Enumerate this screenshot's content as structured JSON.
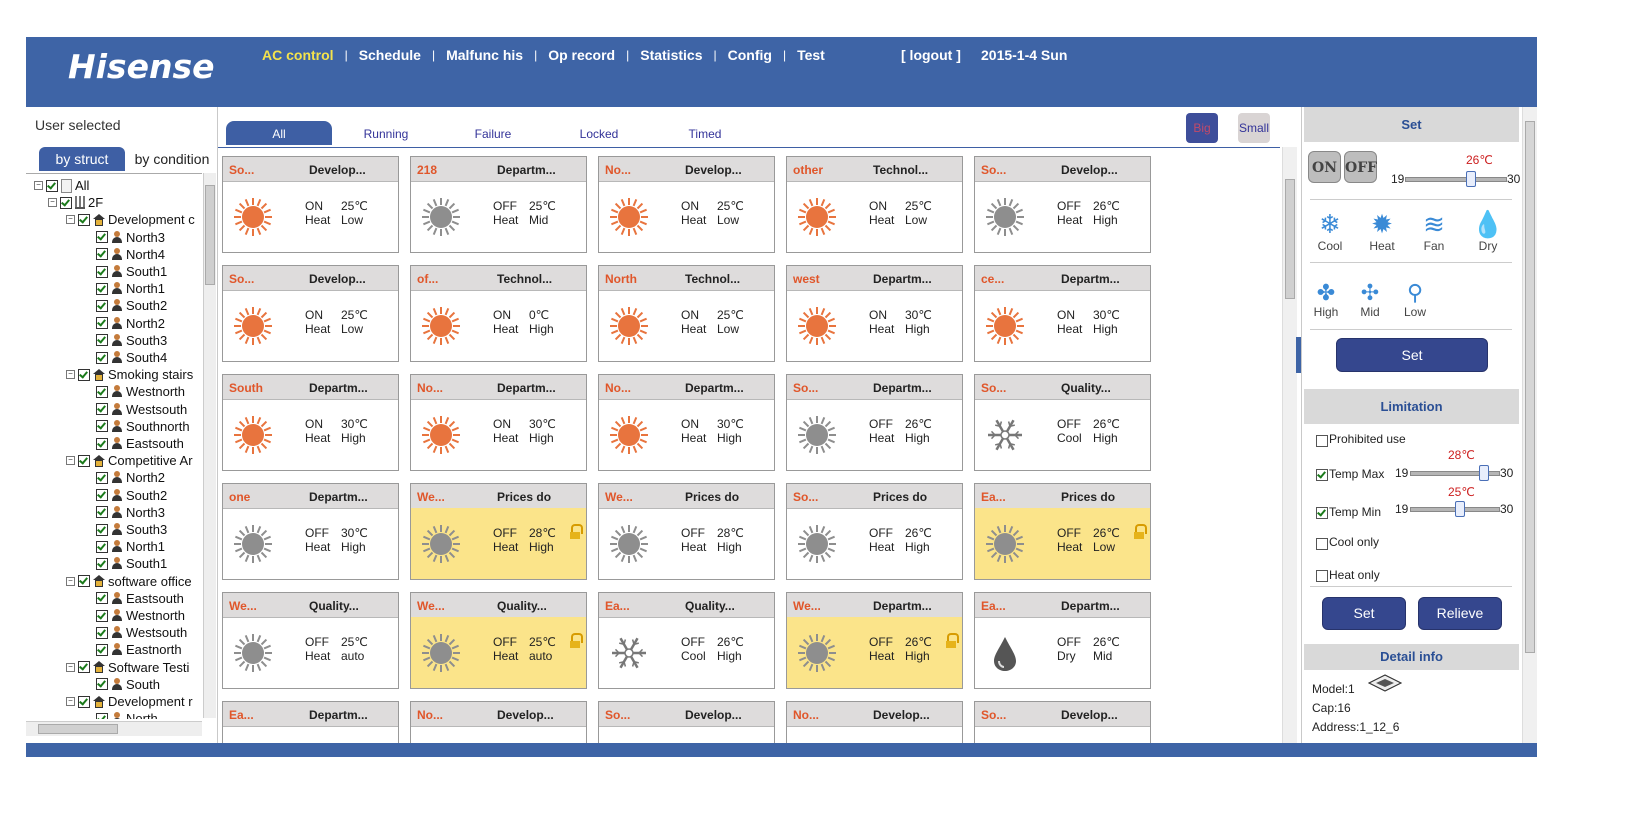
{
  "header": {
    "logo": "Hisense",
    "nav": [
      {
        "label": "AC control",
        "active": true
      },
      {
        "label": "Schedule"
      },
      {
        "label": "Malfunc his"
      },
      {
        "label": "Op record"
      },
      {
        "label": "Statistics"
      },
      {
        "label": "Config"
      },
      {
        "label": "Test"
      }
    ],
    "separator": "|",
    "logout": "[ logout ]",
    "date": "2015-1-4 Sun"
  },
  "left": {
    "title": "User selected",
    "tab_struct": "by struct",
    "tab_condition": "by condition",
    "tree": [
      {
        "label": "All",
        "level": 0,
        "icon": "doc",
        "toggle": "-"
      },
      {
        "label": "2F",
        "level": 1,
        "icon": "building",
        "toggle": "-"
      },
      {
        "label": "Development c",
        "level": 2,
        "icon": "home",
        "toggle": "-"
      },
      {
        "label": "North3",
        "level": 3,
        "icon": "user"
      },
      {
        "label": "North4",
        "level": 3,
        "icon": "user"
      },
      {
        "label": "South1",
        "level": 3,
        "icon": "user"
      },
      {
        "label": "North1",
        "level": 3,
        "icon": "user"
      },
      {
        "label": "South2",
        "level": 3,
        "icon": "user"
      },
      {
        "label": "North2",
        "level": 3,
        "icon": "user"
      },
      {
        "label": "South3",
        "level": 3,
        "icon": "user"
      },
      {
        "label": "South4",
        "level": 3,
        "icon": "user"
      },
      {
        "label": "Smoking stairs",
        "level": 2,
        "icon": "home",
        "toggle": "-"
      },
      {
        "label": "Westnorth",
        "level": 3,
        "icon": "user"
      },
      {
        "label": "Westsouth",
        "level": 3,
        "icon": "user"
      },
      {
        "label": "Southnorth",
        "level": 3,
        "icon": "user"
      },
      {
        "label": "Eastsouth",
        "level": 3,
        "icon": "user"
      },
      {
        "label": "Competitive Ar",
        "level": 2,
        "icon": "home",
        "toggle": "-"
      },
      {
        "label": "North2",
        "level": 3,
        "icon": "user"
      },
      {
        "label": "South2",
        "level": 3,
        "icon": "user"
      },
      {
        "label": "North3",
        "level": 3,
        "icon": "user"
      },
      {
        "label": "South3",
        "level": 3,
        "icon": "user"
      },
      {
        "label": "North1",
        "level": 3,
        "icon": "user"
      },
      {
        "label": "South1",
        "level": 3,
        "icon": "user"
      },
      {
        "label": "software office",
        "level": 2,
        "icon": "home",
        "toggle": "-"
      },
      {
        "label": "Eastsouth",
        "level": 3,
        "icon": "user"
      },
      {
        "label": "Westnorth",
        "level": 3,
        "icon": "user"
      },
      {
        "label": "Westsouth",
        "level": 3,
        "icon": "user"
      },
      {
        "label": "Eastnorth",
        "level": 3,
        "icon": "user"
      },
      {
        "label": "Software Testi",
        "level": 2,
        "icon": "home",
        "toggle": "-"
      },
      {
        "label": "South",
        "level": 3,
        "icon": "user"
      },
      {
        "label": "Development r",
        "level": 2,
        "icon": "home",
        "toggle": "-"
      },
      {
        "label": "North",
        "level": 3,
        "icon": "user"
      }
    ]
  },
  "filter_tabs": [
    {
      "label": "All",
      "active": true
    },
    {
      "label": "Running"
    },
    {
      "label": "Failure"
    },
    {
      "label": "Locked"
    },
    {
      "label": "Timed"
    }
  ],
  "view": {
    "big": "Big",
    "small": "Small"
  },
  "cards": [
    {
      "zone": "So...",
      "dept": "Develop...",
      "power": "ON",
      "temp": "25℃",
      "mode": "Heat",
      "fan": "Low",
      "icon": "heat-on"
    },
    {
      "zone": "218",
      "dept": "Departm...",
      "power": "OFF",
      "temp": "25℃",
      "mode": "Heat",
      "fan": "Mid",
      "icon": "heat-off"
    },
    {
      "zone": "No...",
      "dept": "Develop...",
      "power": "ON",
      "temp": "25℃",
      "mode": "Heat",
      "fan": "Low",
      "icon": "heat-on"
    },
    {
      "zone": "other",
      "dept": "Technol...",
      "power": "ON",
      "temp": "25℃",
      "mode": "Heat",
      "fan": "Low",
      "icon": "heat-on"
    },
    {
      "zone": "So...",
      "dept": "Develop...",
      "power": "OFF",
      "temp": "26℃",
      "mode": "Heat",
      "fan": "High",
      "icon": "heat-off"
    },
    {
      "zone": "So...",
      "dept": "Develop...",
      "power": "ON",
      "temp": "25℃",
      "mode": "Heat",
      "fan": "Low",
      "icon": "heat-on"
    },
    {
      "zone": "of...",
      "dept": "Technol...",
      "power": "ON",
      "temp": "0℃",
      "mode": "Heat",
      "fan": "High",
      "icon": "heat-on"
    },
    {
      "zone": "North",
      "dept": "Technol...",
      "power": "ON",
      "temp": "25℃",
      "mode": "Heat",
      "fan": "Low",
      "icon": "heat-on"
    },
    {
      "zone": "west",
      "dept": "Departm...",
      "power": "ON",
      "temp": "30℃",
      "mode": "Heat",
      "fan": "High",
      "icon": "heat-on"
    },
    {
      "zone": "ce...",
      "dept": "Departm...",
      "power": "ON",
      "temp": "30℃",
      "mode": "Heat",
      "fan": "High",
      "icon": "heat-on"
    },
    {
      "zone": "South",
      "dept": "Departm...",
      "power": "ON",
      "temp": "30℃",
      "mode": "Heat",
      "fan": "High",
      "icon": "heat-on"
    },
    {
      "zone": "No...",
      "dept": "Departm...",
      "power": "ON",
      "temp": "30℃",
      "mode": "Heat",
      "fan": "High",
      "icon": "heat-on"
    },
    {
      "zone": "No...",
      "dept": "Departm...",
      "power": "ON",
      "temp": "30℃",
      "mode": "Heat",
      "fan": "High",
      "icon": "heat-on"
    },
    {
      "zone": "So...",
      "dept": "Departm...",
      "power": "OFF",
      "temp": "26℃",
      "mode": "Heat",
      "fan": "High",
      "icon": "heat-off"
    },
    {
      "zone": "So...",
      "dept": "Quality...",
      "power": "OFF",
      "temp": "26℃",
      "mode": "Cool",
      "fan": "High",
      "icon": "cool-off"
    },
    {
      "zone": "one",
      "dept": "Departm...",
      "power": "OFF",
      "temp": "30℃",
      "mode": "Heat",
      "fan": "High",
      "icon": "heat-off"
    },
    {
      "zone": "We...",
      "dept": "Prices do",
      "power": "OFF",
      "temp": "28℃",
      "mode": "Heat",
      "fan": "High",
      "icon": "heat-off",
      "locked": true
    },
    {
      "zone": "We...",
      "dept": "Prices do",
      "power": "OFF",
      "temp": "28℃",
      "mode": "Heat",
      "fan": "High",
      "icon": "heat-off"
    },
    {
      "zone": "So...",
      "dept": "Prices do",
      "power": "OFF",
      "temp": "26℃",
      "mode": "Heat",
      "fan": "High",
      "icon": "heat-off"
    },
    {
      "zone": "Ea...",
      "dept": "Prices do",
      "power": "OFF",
      "temp": "26℃",
      "mode": "Heat",
      "fan": "Low",
      "icon": "heat-off",
      "locked": true
    },
    {
      "zone": "We...",
      "dept": "Quality...",
      "power": "OFF",
      "temp": "25℃",
      "mode": "Heat",
      "fan": "auto",
      "icon": "heat-off"
    },
    {
      "zone": "We...",
      "dept": "Quality...",
      "power": "OFF",
      "temp": "25℃",
      "mode": "Heat",
      "fan": "auto",
      "icon": "heat-off",
      "locked": true
    },
    {
      "zone": "Ea...",
      "dept": "Quality...",
      "power": "OFF",
      "temp": "26℃",
      "mode": "Cool",
      "fan": "High",
      "icon": "cool-off"
    },
    {
      "zone": "We...",
      "dept": "Departm...",
      "power": "OFF",
      "temp": "26℃",
      "mode": "Heat",
      "fan": "High",
      "icon": "heat-off",
      "locked": true
    },
    {
      "zone": "Ea...",
      "dept": "Departm...",
      "power": "OFF",
      "temp": "26℃",
      "mode": "Dry",
      "fan": "Mid",
      "icon": "dry-off"
    },
    {
      "zone": "Ea...",
      "dept": "Departm..."
    },
    {
      "zone": "No...",
      "dept": "Develop..."
    },
    {
      "zone": "So...",
      "dept": "Develop..."
    },
    {
      "zone": "No...",
      "dept": "Develop..."
    },
    {
      "zone": "So...",
      "dept": "Develop..."
    }
  ],
  "right": {
    "set_title": "Set",
    "on": "ON",
    "off": "OFF",
    "set_temp": "26℃",
    "set_temp_value": 26,
    "range_min": "19",
    "range_max": "30",
    "modes": [
      "Cool",
      "Heat",
      "Fan",
      "Dry"
    ],
    "fans": [
      "High",
      "Mid",
      "Low"
    ],
    "set_button": "Set",
    "limit_title": "Limitation",
    "prohibited": "Prohibited use",
    "temp_max_label": "Temp Max",
    "temp_max": "28℃",
    "temp_max_value": 28,
    "temp_min_label": "Temp Min",
    "temp_min": "25℃",
    "temp_min_value": 25,
    "cool_only": "Cool only",
    "heat_only": "Heat only",
    "limit_set": "Set",
    "relieve": "Relieve",
    "detail_title": "Detail info",
    "model": "Model:1",
    "cap": "Cap:16",
    "address": "Address:1_12_6"
  }
}
